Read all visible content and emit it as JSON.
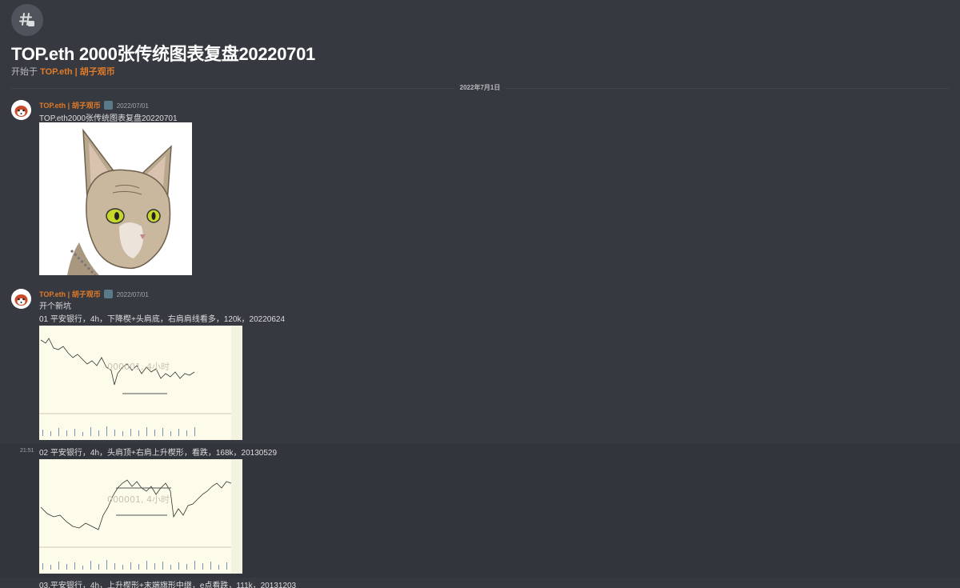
{
  "thread": {
    "icon": "thread-icon",
    "title": "TOP.eth 2000张传统图表复盘20220701",
    "started_by_prefix": "开始于",
    "started_by_author": "TOP.eth | 胡子观币"
  },
  "date_divider": "2022年7月1日",
  "messages": [
    {
      "author": "TOP.eth | 胡子观币",
      "timestamp": "2022/07/01",
      "text": "TOP.eth2000张传统图表复盘20220701",
      "attachment": "sphynx-cat-illustration"
    },
    {
      "author": "TOP.eth | 胡子观币",
      "timestamp": "2022/07/01",
      "text": "开个新坑",
      "text2": "01 平安银行，4h，下降楔+头肩底，右肩肩线看多，120k，20220624",
      "attachment": "candlestick-chart"
    },
    {
      "side_time": "21:51",
      "text": "02 平安银行，4h，头肩顶+右肩上升楔形，看跌，168k，20130529",
      "attachment": "candlestick-chart"
    },
    {
      "text": "03.平安银行，4h，上升楔形+末端旗形中继，e点看跌，111k，20131203"
    }
  ],
  "chart_watermarks": [
    "000001, 4小时",
    "000001, 4小时"
  ],
  "colors": {
    "background": "#36393f",
    "author": "#e07b2a",
    "title": "#ffffff",
    "text": "#dcddde",
    "chart_background": "#fdfbea"
  }
}
